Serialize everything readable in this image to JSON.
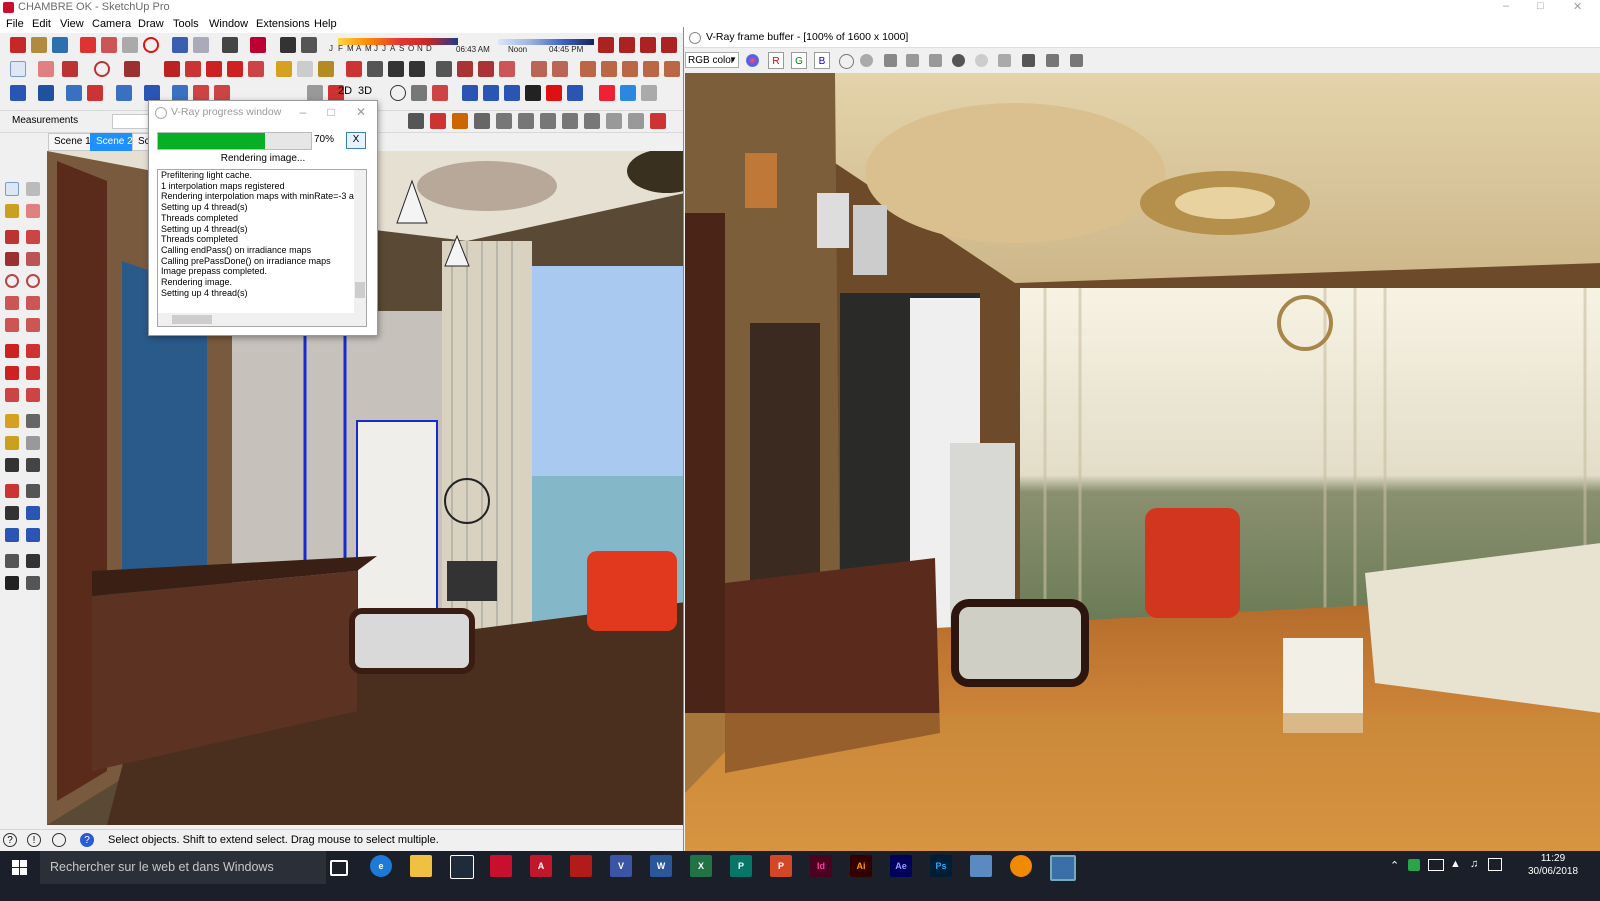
{
  "sketchup": {
    "title": "CHAMBRE OK - SketchUp Pro",
    "menu": [
      "File",
      "Edit",
      "View",
      "Camera",
      "Draw",
      "Tools",
      "Window",
      "Extensions",
      "Help"
    ],
    "months": [
      "J",
      "F",
      "M",
      "A",
      "M",
      "J",
      "J",
      "A",
      "S",
      "O",
      "N",
      "D"
    ],
    "time_morning": "06:43 AM",
    "time_noon": "Noon",
    "time_evening": "04:45 PM",
    "toggle_2d": "2D",
    "toggle_3d": "3D",
    "measurements_label": "Measurements",
    "scenes": [
      "Scene 1",
      "Scene 2",
      "Sc"
    ],
    "active_scene_index": 1,
    "status_text": "Select objects. Shift to extend select. Drag mouse to select multiple."
  },
  "progress_window": {
    "title": "V-Ray progress window",
    "percent_label": "70%",
    "progress": 0.7,
    "cancel_label": "X",
    "status": "Rendering image...",
    "log": [
      "Prefiltering light cache.",
      " 1 interpolation maps registered",
      "Rendering interpolation maps with minRate=-3 a",
      "Setting up 4 thread(s)",
      "Threads completed",
      "Setting up 4 thread(s)",
      "Threads completed",
      "Calling endPass() on irradiance maps",
      "Calling prePassDone() on irradiance maps",
      "Image prepass completed.",
      "Rendering image.",
      "Setting up 4 thread(s)"
    ]
  },
  "frame_buffer": {
    "title": "V-Ray frame buffer - [100% of 1600 x 1000]",
    "channel": "RGB color",
    "channel_buttons": [
      "R",
      "G",
      "B"
    ]
  },
  "taskbar": {
    "search_placeholder": "Rechercher sur le web et dans Windows",
    "apps": [
      "Task View",
      "Edge",
      "File Explorer",
      "Store",
      "SketchUp",
      "AutoCAD",
      "Acrobat",
      "Visio",
      "Word",
      "Excel",
      "Publisher",
      "PowerPoint",
      "InDesign",
      "Illustrator",
      "After Effects",
      "Photoshop",
      "Network",
      "VLC",
      "Image Viewer"
    ],
    "app_labels": [
      "V",
      "W",
      "X",
      "P",
      "P",
      "Id",
      "Ai",
      "Ae",
      "Ps"
    ],
    "time": "11:29",
    "date": "30/06/2018"
  },
  "colors": {
    "accent_blue": "#1e90ff",
    "progress_green": "#06b025",
    "taskbar": "#1a1f29"
  }
}
